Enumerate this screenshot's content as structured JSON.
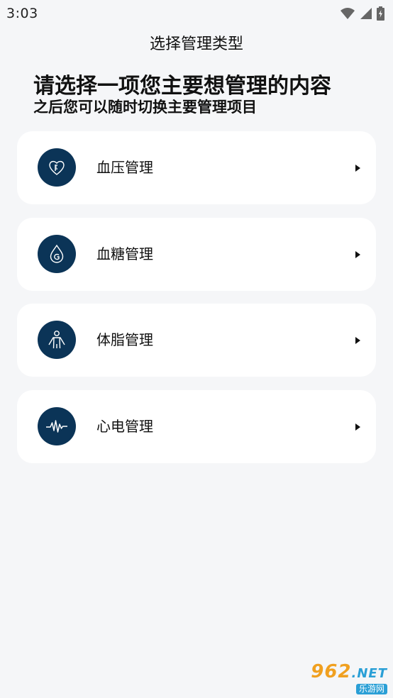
{
  "status_bar": {
    "time": "3:03",
    "icons": [
      "wifi-icon",
      "signal-icon",
      "battery-icon"
    ]
  },
  "header": {
    "title": "选择管理类型"
  },
  "prompt": {
    "main": "请选择一项您主要想管理的内容",
    "sub": "之后您可以随时切换主要管理项目"
  },
  "cards": [
    {
      "label": "血压管理",
      "icon": "heart-pressure-icon"
    },
    {
      "label": "血糖管理",
      "icon": "glucose-drop-icon"
    },
    {
      "label": "体脂管理",
      "icon": "body-figure-icon"
    },
    {
      "label": "心电管理",
      "icon": "ecg-wave-icon"
    }
  ],
  "watermark": {
    "top": "962",
    "net": ".NET",
    "bottom": "乐游网"
  },
  "colors": {
    "background": "#f5f6f8",
    "card": "#ffffff",
    "icon_circle": "#0b3457"
  }
}
